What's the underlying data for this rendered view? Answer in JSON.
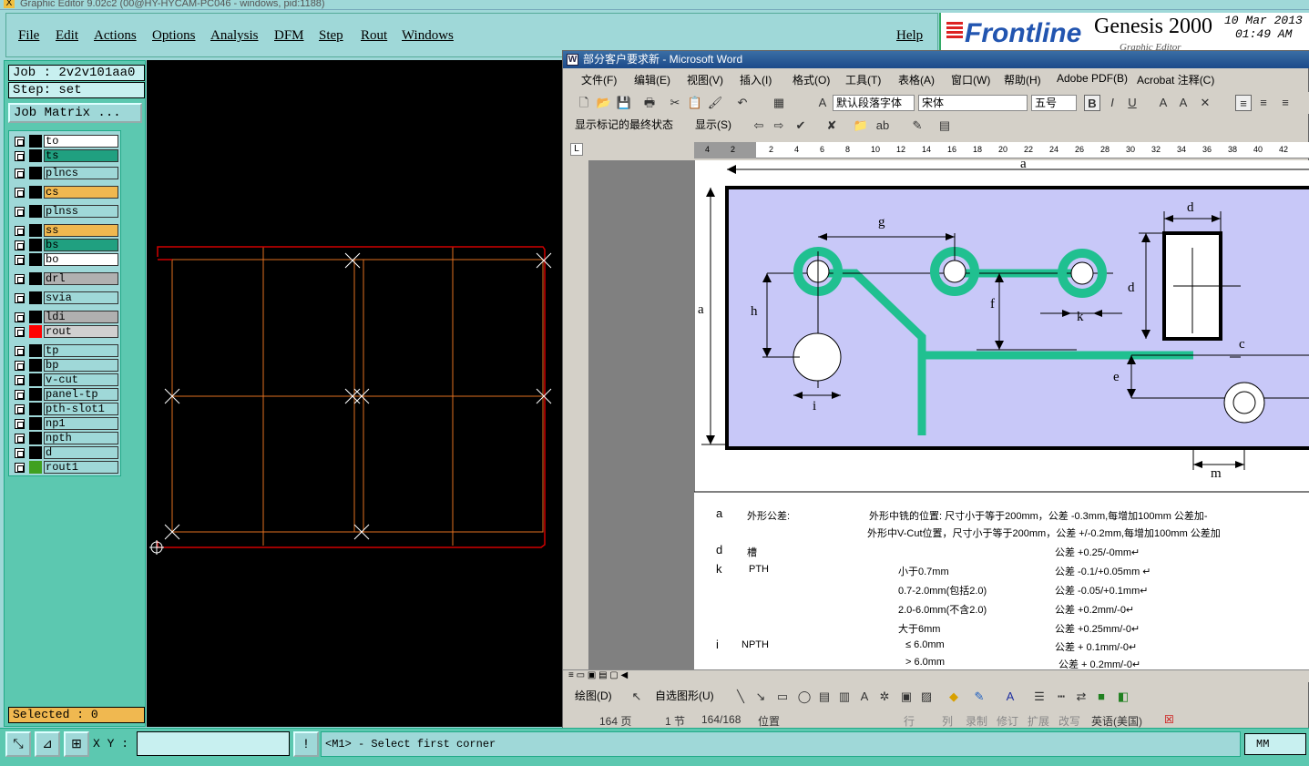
{
  "genesis": {
    "window_title": "Graphic Editor 9.02c2 (00@HY-HYCAM-PC046 - windows, pid:1188)",
    "menu": [
      "File",
      "Edit",
      "Actions",
      "Options",
      "Analysis",
      "DFM",
      "Step",
      "Rout",
      "Windows"
    ],
    "help": "Help",
    "logo": {
      "brand": "Frontline",
      "product": "Genesis 2000",
      "subtitle": "Graphic Editor",
      "date": "10 Mar 2013",
      "time": "01:49 AM"
    },
    "job": "Job : 2v2v101aa0",
    "step": "Step: set",
    "job_matrix": "Job Matrix ...",
    "layers": [
      {
        "name": "to",
        "color": "#000000",
        "bg": "#ffffff"
      },
      {
        "name": "ts",
        "color": "#000000",
        "bg": "#20a080"
      },
      {
        "name": "plncs",
        "color": "#000000",
        "bg": "#9fd8d8"
      },
      {
        "name": "cs",
        "color": "#000000",
        "bg": "#f0b850"
      },
      {
        "name": "plnss",
        "color": "#000000",
        "bg": "#9fd8d8"
      },
      {
        "name": "ss",
        "color": "#000000",
        "bg": "#f0b850"
      },
      {
        "name": "bs",
        "color": "#000000",
        "bg": "#20a080"
      },
      {
        "name": "bo",
        "color": "#000000",
        "bg": "#ffffff"
      },
      {
        "name": "drl",
        "color": "#000000",
        "bg": "#b0b0b0"
      },
      {
        "name": "svia",
        "color": "#000000",
        "bg": "#9fd8d8"
      },
      {
        "name": "ldi",
        "color": "#000000",
        "bg": "#b0b0b0"
      },
      {
        "name": "rout",
        "color": "#ff0000",
        "bg": "#d0d0d0"
      },
      {
        "name": "tp",
        "color": "#000000",
        "bg": "#9fd8d8"
      },
      {
        "name": "bp",
        "color": "#000000",
        "bg": "#9fd8d8"
      },
      {
        "name": "v-cut",
        "color": "#000000",
        "bg": "#9fd8d8"
      },
      {
        "name": "panel-tp",
        "color": "#000000",
        "bg": "#9fd8d8"
      },
      {
        "name": "pth-slot1",
        "color": "#000000",
        "bg": "#9fd8d8"
      },
      {
        "name": "np1",
        "color": "#000000",
        "bg": "#9fd8d8"
      },
      {
        "name": "npth",
        "color": "#000000",
        "bg": "#9fd8d8"
      },
      {
        "name": "d",
        "color": "#000000",
        "bg": "#9fd8d8"
      },
      {
        "name": "rout1",
        "color": "#40a020",
        "bg": "#9fd8d8"
      }
    ],
    "selected": "Selected : 0",
    "xy_label": "X Y :",
    "xy_value": "",
    "prompt": "<M1> - Select first corner",
    "units": "MM"
  },
  "word": {
    "title": "部分客户要求新 - Microsoft Word",
    "menu": [
      "文件(F)",
      "编辑(E)",
      "视图(V)",
      "插入(I)",
      "格式(O)",
      "工具(T)",
      "表格(A)",
      "窗口(W)",
      "帮助(H)",
      "Adobe PDF(B)",
      "Acrobat 注释(C)"
    ],
    "style": "默认段落字体",
    "font": "宋体",
    "size": "五号",
    "markup_state": "显示标记的最终状态",
    "show_menu": "显示(S)",
    "ruler": [
      "4",
      "2",
      "2",
      "4",
      "6",
      "8",
      "10",
      "12",
      "14",
      "16",
      "18",
      "20",
      "22",
      "24",
      "26",
      "28",
      "30",
      "32",
      "34",
      "36",
      "38",
      "40",
      "42"
    ],
    "draw_label": "绘图(D)",
    "autoshapes": "自选图形(U)",
    "status": {
      "page": "164 页",
      "section": "1 节",
      "pages": "164/168",
      "position": "位置",
      "line": "行",
      "col": "列",
      "rec": "录制",
      "trk": "修订",
      "ext": "扩展",
      "ovr": "改写",
      "lang": "英语(美国)"
    },
    "diagram_labels": {
      "a_top": "a",
      "a": "a",
      "g": "g",
      "d_top": "d",
      "d": "d",
      "h": "h",
      "f": "f",
      "k": "k",
      "e": "e",
      "i": "i",
      "c": "c",
      "m": "m"
    },
    "spec_lines": [
      {
        "c1": "a",
        "c2": "外形公差:",
        "c3": "外形中铣的位置:  尺寸小于等于200mm，公差 -0.3mm,每增加100mm 公差加-"
      },
      {
        "c1": "",
        "c2": "",
        "c3": "外形中V-Cut位置，尺寸小于等于200mm，公差 +/-0.2mm,每增加100mm 公差加"
      },
      {
        "c1": "d",
        "c2": "槽",
        "c3": "公差 +0.25/-0mm↵"
      },
      {
        "c1": "k",
        "c2": "PTH",
        "c3": "小于0.7mm",
        "c4": "公差 -0.1/+0.05mm ↵"
      },
      {
        "c1": "",
        "c2": "",
        "c3": "0.7-2.0mm(包括2.0)",
        "c4": "公差  -0.05/+0.1mm↵"
      },
      {
        "c1": "",
        "c2": "",
        "c3": "2.0-6.0mm(不含2.0)",
        "c4": "公差 +0.2mm/-0↵"
      },
      {
        "c1": "",
        "c2": "",
        "c3": "大于6mm",
        "c4": "公差 +0.25mm/-0↵"
      },
      {
        "c1": "i",
        "c2": "NPTH",
        "c3": "≤ 6.0mm",
        "c4": "公差 + 0.1mm/-0↵"
      },
      {
        "c1": "",
        "c2": "",
        "c3": "> 6.0mm",
        "c4": "公差 + 0.2mm/-0↵"
      }
    ]
  }
}
